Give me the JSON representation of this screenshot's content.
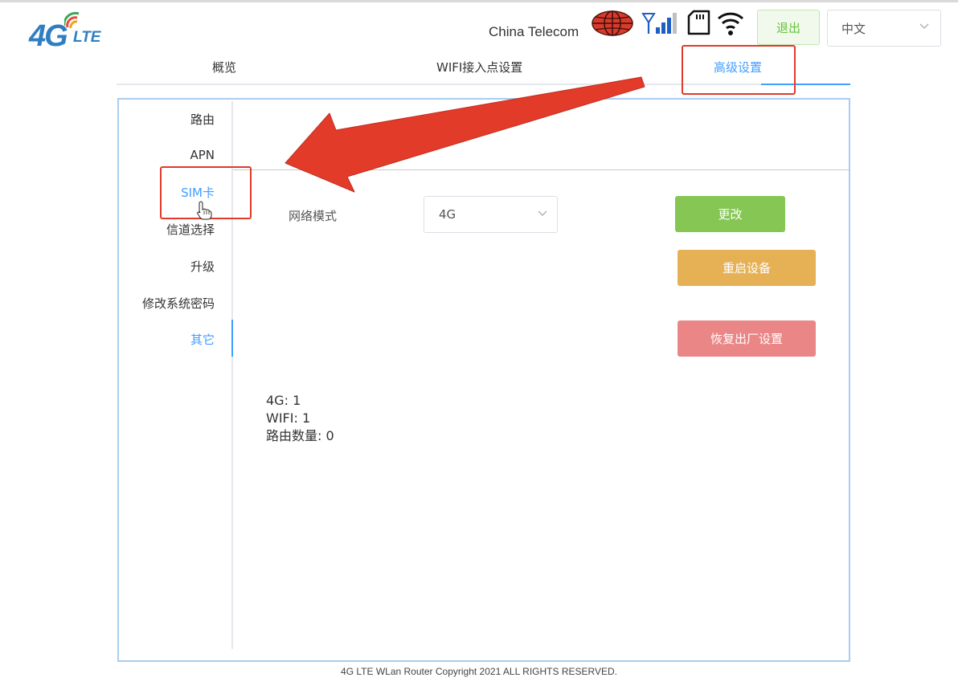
{
  "logo": {
    "main": "4G",
    "suffix": "LTE"
  },
  "header": {
    "carrier": "China Telecom",
    "logout_label": "退出",
    "language": {
      "selected": "中文"
    }
  },
  "tabs": [
    {
      "label": "概览",
      "active": false
    },
    {
      "label": "WIFI接入点设置",
      "active": false
    },
    {
      "label": "高级设置",
      "active": true
    }
  ],
  "sidebar": {
    "items": [
      {
        "label": "路由",
        "active": false
      },
      {
        "label": "APN",
        "active": false
      },
      {
        "label": "SIM卡",
        "active": false,
        "hovered": true
      },
      {
        "label": "信道选择",
        "active": false
      },
      {
        "label": "升级",
        "active": false
      },
      {
        "label": "修改系统密码",
        "active": false
      },
      {
        "label": "其它",
        "active": true
      }
    ]
  },
  "content": {
    "network_mode": {
      "label": "网络模式",
      "selected": "4G"
    },
    "buttons": {
      "change": "更改",
      "reboot": "重启设备",
      "factory_reset": "恢复出厂设置"
    },
    "stats": [
      {
        "label": "4G",
        "value": "1"
      },
      {
        "label": "WIFI",
        "value": "1"
      },
      {
        "label": "路由数量",
        "value": "0"
      }
    ]
  },
  "footer": {
    "text": "4G LTE WLan Router Copyright 2021 ALL RIGHTS RESERVED."
  },
  "colors": {
    "accent": "#409eff",
    "change_button": "#85c654",
    "reboot_button": "#e6b155",
    "reset_button": "#ea8686",
    "annotation": "#e03a2a"
  },
  "icons": [
    "globe-icon",
    "signal-icon",
    "sim-card-icon",
    "wifi-icon",
    "chevron-down-icon",
    "hand-cursor-icon",
    "annotation-arrow"
  ]
}
